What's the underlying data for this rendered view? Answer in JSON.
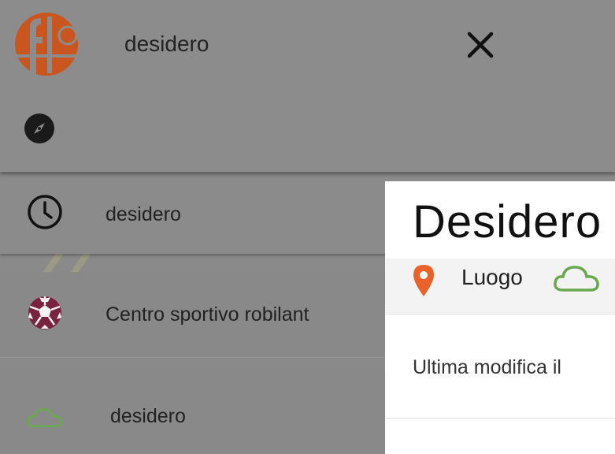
{
  "search": {
    "query": "desidero"
  },
  "results": [
    {
      "label": "desidero",
      "icon": "clock-icon"
    },
    {
      "label": "Centro sportivo robilant",
      "icon": "soccer-ball-icon"
    },
    {
      "label": "desidero",
      "icon": "cloud-icon"
    }
  ],
  "detail": {
    "title": "Desidero",
    "place_label": "Luogo",
    "last_modified": "Ultima modifica il"
  },
  "colors": {
    "logo_orange": "#d4501e",
    "pin_orange": "#e8622a",
    "cloud_green": "#6aa84f",
    "ball_purple": "#7a2340"
  }
}
